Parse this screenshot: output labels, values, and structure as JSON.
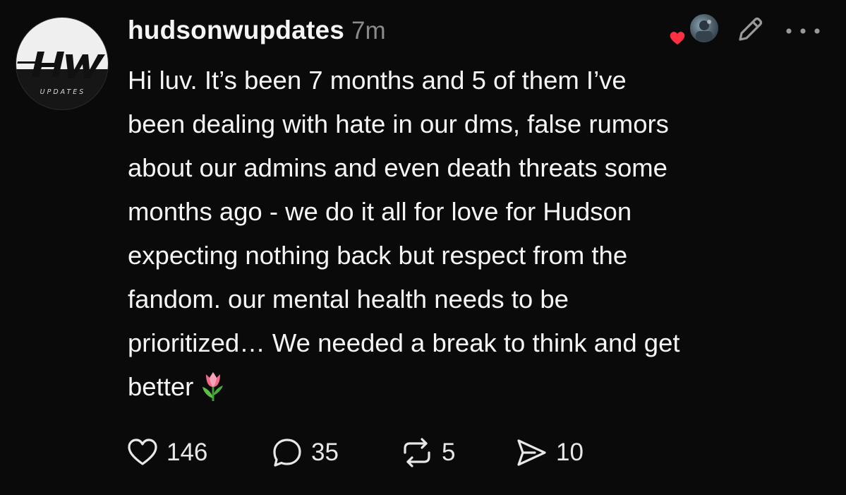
{
  "post": {
    "username": "hudsonwupdates",
    "time": "7m",
    "avatar": {
      "logo_text": "HW",
      "subtitle": "UPDATES"
    },
    "body": "Hi luv. It’s been 7 months and 5 of them I’ve\nbeen dealing with hate in our dms, false rumors\nabout our admins and even death threats some\nmonths ago - we do it all for love for Hudson\nexpecting nothing back but respect from the\nfandom. our mental health needs to be\nprioritized… We needed a break to think and get\nbetter",
    "emoji": "tulip"
  },
  "actions": {
    "likes": "146",
    "comments": "35",
    "reposts": "5",
    "shares": "10"
  },
  "icons": {
    "like": "heart-icon",
    "comment": "comment-bubble-icon",
    "repost": "repost-icon",
    "share": "share-send-icon",
    "edit": "pencil-icon",
    "more": "more-dots-icon",
    "liked_badge": "heart-badge-icon"
  },
  "colors": {
    "background": "#0a0a0a",
    "text": "#f5f5f5",
    "muted": "#8a8a8a",
    "heart_badge": "#ff3040"
  }
}
